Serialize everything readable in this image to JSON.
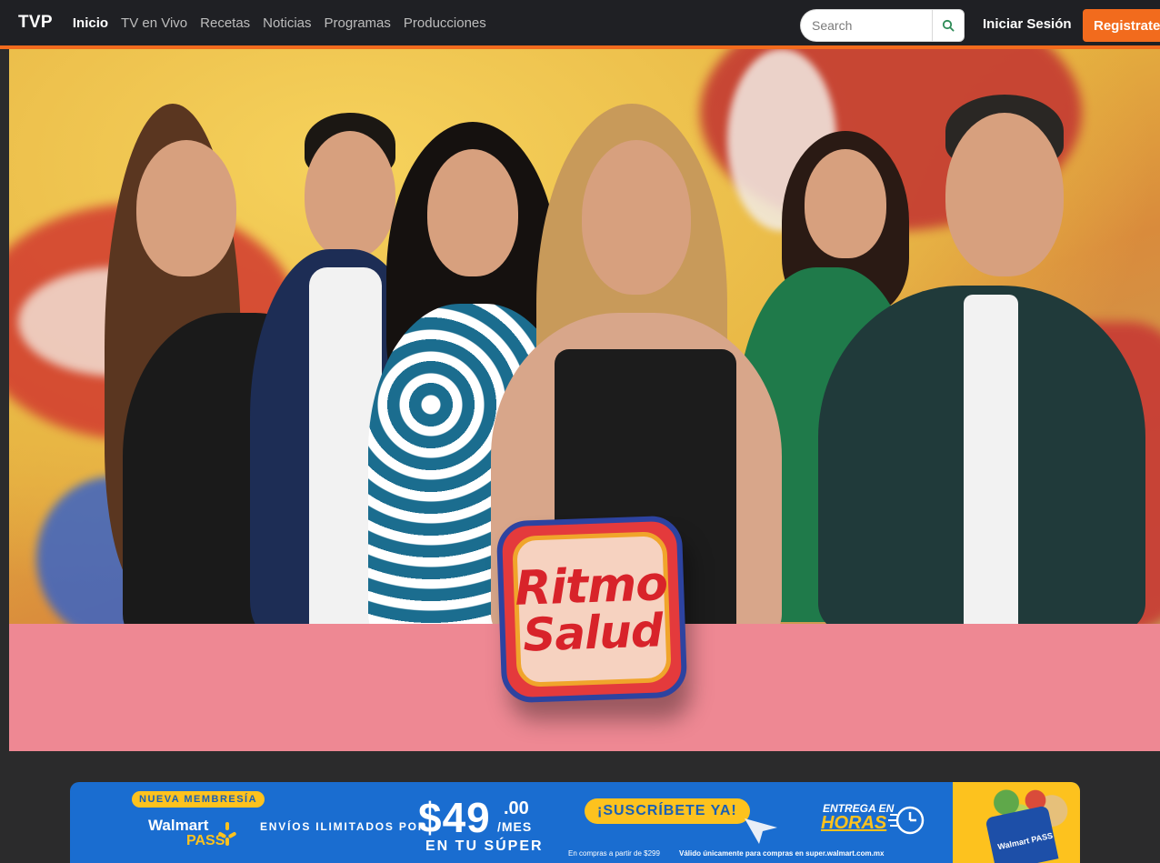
{
  "nav": {
    "brand": "TVP",
    "links": [
      {
        "label": "Inicio",
        "active": true
      },
      {
        "label": "TV en Vivo",
        "active": false
      },
      {
        "label": "Recetas",
        "active": false
      },
      {
        "label": "Noticias",
        "active": false
      },
      {
        "label": "Programas",
        "active": false
      },
      {
        "label": "Producciones",
        "active": false
      }
    ],
    "search_placeholder": "Search",
    "search_icon": "search-icon",
    "login_label": "Iniciar Sesión",
    "register_label": "Registrate"
  },
  "hero": {
    "show_logo_line1": "Ritmo",
    "show_logo_line2": "Salud",
    "accent_color": "#f26b1d",
    "band_color": "#ee8893"
  },
  "ad": {
    "tag": "NUEVA MEMBRESÍA",
    "brand": "Walmart",
    "brand_sub": "PASS",
    "envios": "ENVÍOS ILIMITADOS POR",
    "price": "$49",
    "cents": ".00",
    "per": "/MES",
    "location": "EN TU SÚPER",
    "cta": "¡SUSCRÍBETE YA!",
    "delivery_line1": "ENTREGA EN",
    "delivery_line2": "HORAS",
    "fine_print": "En compras a partir de $299",
    "fine_print2": "Válido únicamente para compras en super.walmart.com.mx",
    "bag_label": "Walmart PASS"
  }
}
